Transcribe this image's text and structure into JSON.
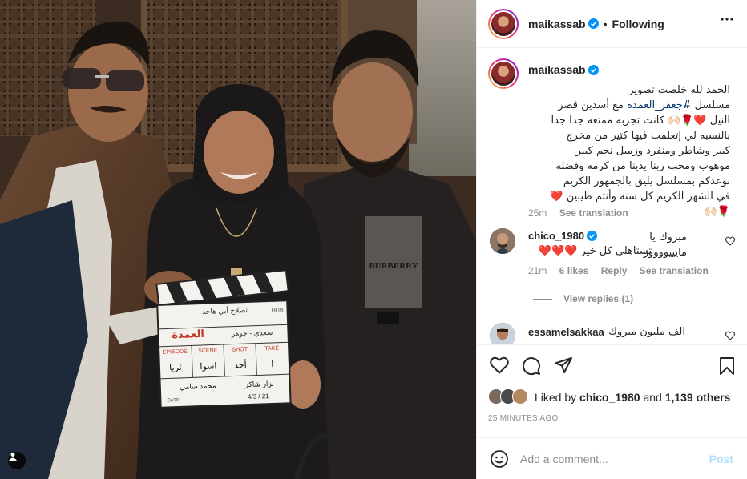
{
  "post": {
    "username": "maikassab",
    "follow_status": "Following",
    "dot": "•"
  },
  "caption": {
    "username": "maikassab",
    "line1": "الحمد لله خلصت تصوير",
    "line2_a": "مسلسل ",
    "hashtag": "#جعفر_العمده",
    "line2_b": " مع أسدين قصر",
    "line3": "النيل ❤️🌹🙌🏻 كانت تجربه ممتعه جدا جدا",
    "line4": "بالنسبه لي إتعلمت فيها كتير من مخرج",
    "line5": "كبير وشاطر ومنفرد وزميل نجم كبير",
    "line6": "موهوب ومحب ربنا يدينا من كرمه وفضله",
    "line7": "نوعدكم بمسلسل يليق بالجمهور الكريم",
    "line8": "في الشهر الكريم كل سنه وأنتم طيبين ❤️",
    "line9": "🌹🙌🏻",
    "age": "25m",
    "see_translation": "See translation"
  },
  "comments": [
    {
      "username": "chico_1980",
      "line1": "مبروك يا مايييووووز",
      "line2": "تستاهلي كل خير ❤️❤️❤️",
      "age": "21m",
      "likes": "6 likes",
      "reply": "Reply",
      "see_translation": "See translation",
      "view_replies": "View replies (1)"
    },
    {
      "username": "essamelsakkaa",
      "line1": "الف مليون مبروك"
    }
  ],
  "likes": {
    "prefix": "Liked by",
    "user": "chico_1980",
    "and": "and",
    "others": "1,139 others"
  },
  "timestamp": "25 MINUTES AGO",
  "add_comment": {
    "placeholder": "Add a comment...",
    "post_label": "Post"
  },
  "clapperboard": {
    "title": "العمدة",
    "row_labels": [
      "EPISODE",
      "SCENE",
      "SHOT",
      "TAKE"
    ],
    "row_values": [
      "ثريا",
      "اسوا",
      "أحد",
      "I"
    ],
    "names": [
      "محمد سامي",
      "نزار شاكر"
    ],
    "subtitle": "سعدي - جوهر",
    "top_text": "تصلاح أبي هاحد",
    "hub": "HUB",
    "date_label": "DATE",
    "date_value": "4/3 / 21"
  },
  "shirt_brand": "BURBERRY",
  "colors": {
    "accent_blue": "#0095f6",
    "hashtag": "#00376b",
    "heart": "#ed4956",
    "muted": "#8e8e8e",
    "border": "#efefef",
    "post_disabled": "#b2dffc"
  }
}
